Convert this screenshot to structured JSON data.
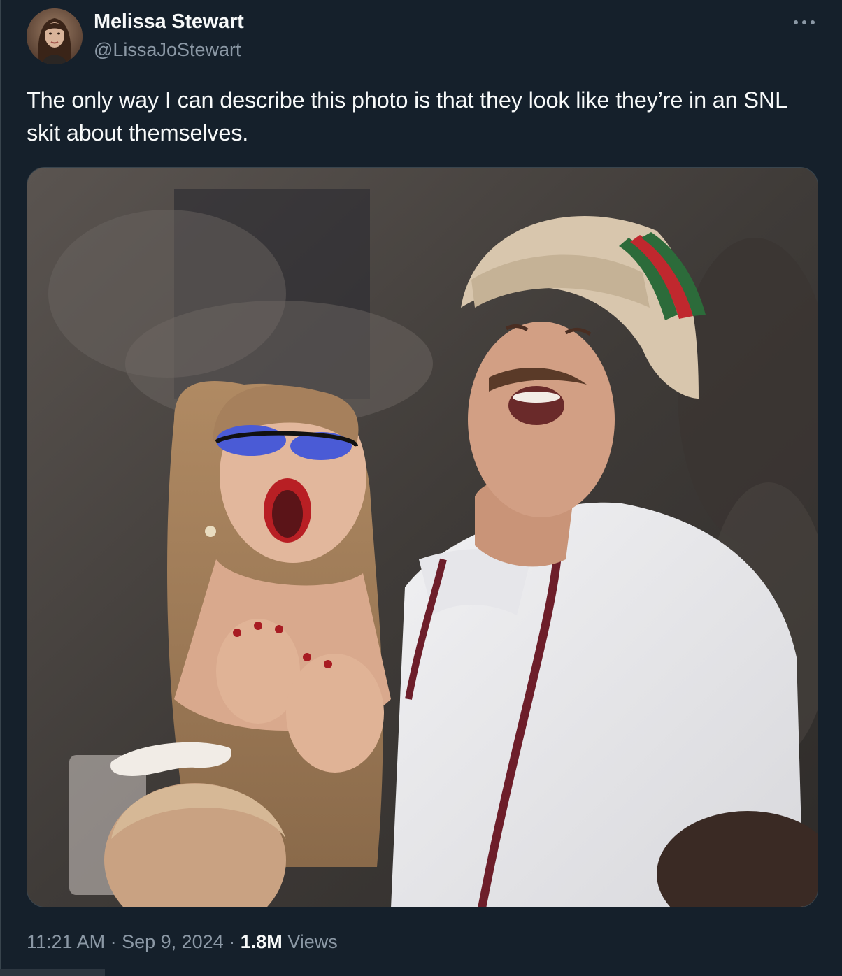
{
  "tweet": {
    "author": {
      "display_name": "Melissa Stewart",
      "handle": "@LissaJoStewart"
    },
    "text": "The only way I can describe this photo is that they look like they’re in an SNL skit about themselves.",
    "more_icon": "more-horizontal-icon",
    "timestamp": {
      "time": "11:21 AM",
      "separator": " · ",
      "date": "Sep 9, 2024"
    },
    "views": {
      "count": "1.8M",
      "label": "Views"
    }
  },
  "colors": {
    "background": "#15202b",
    "text_primary": "#f7f9f9",
    "text_secondary": "#8b98a5",
    "border": "#38444d"
  }
}
